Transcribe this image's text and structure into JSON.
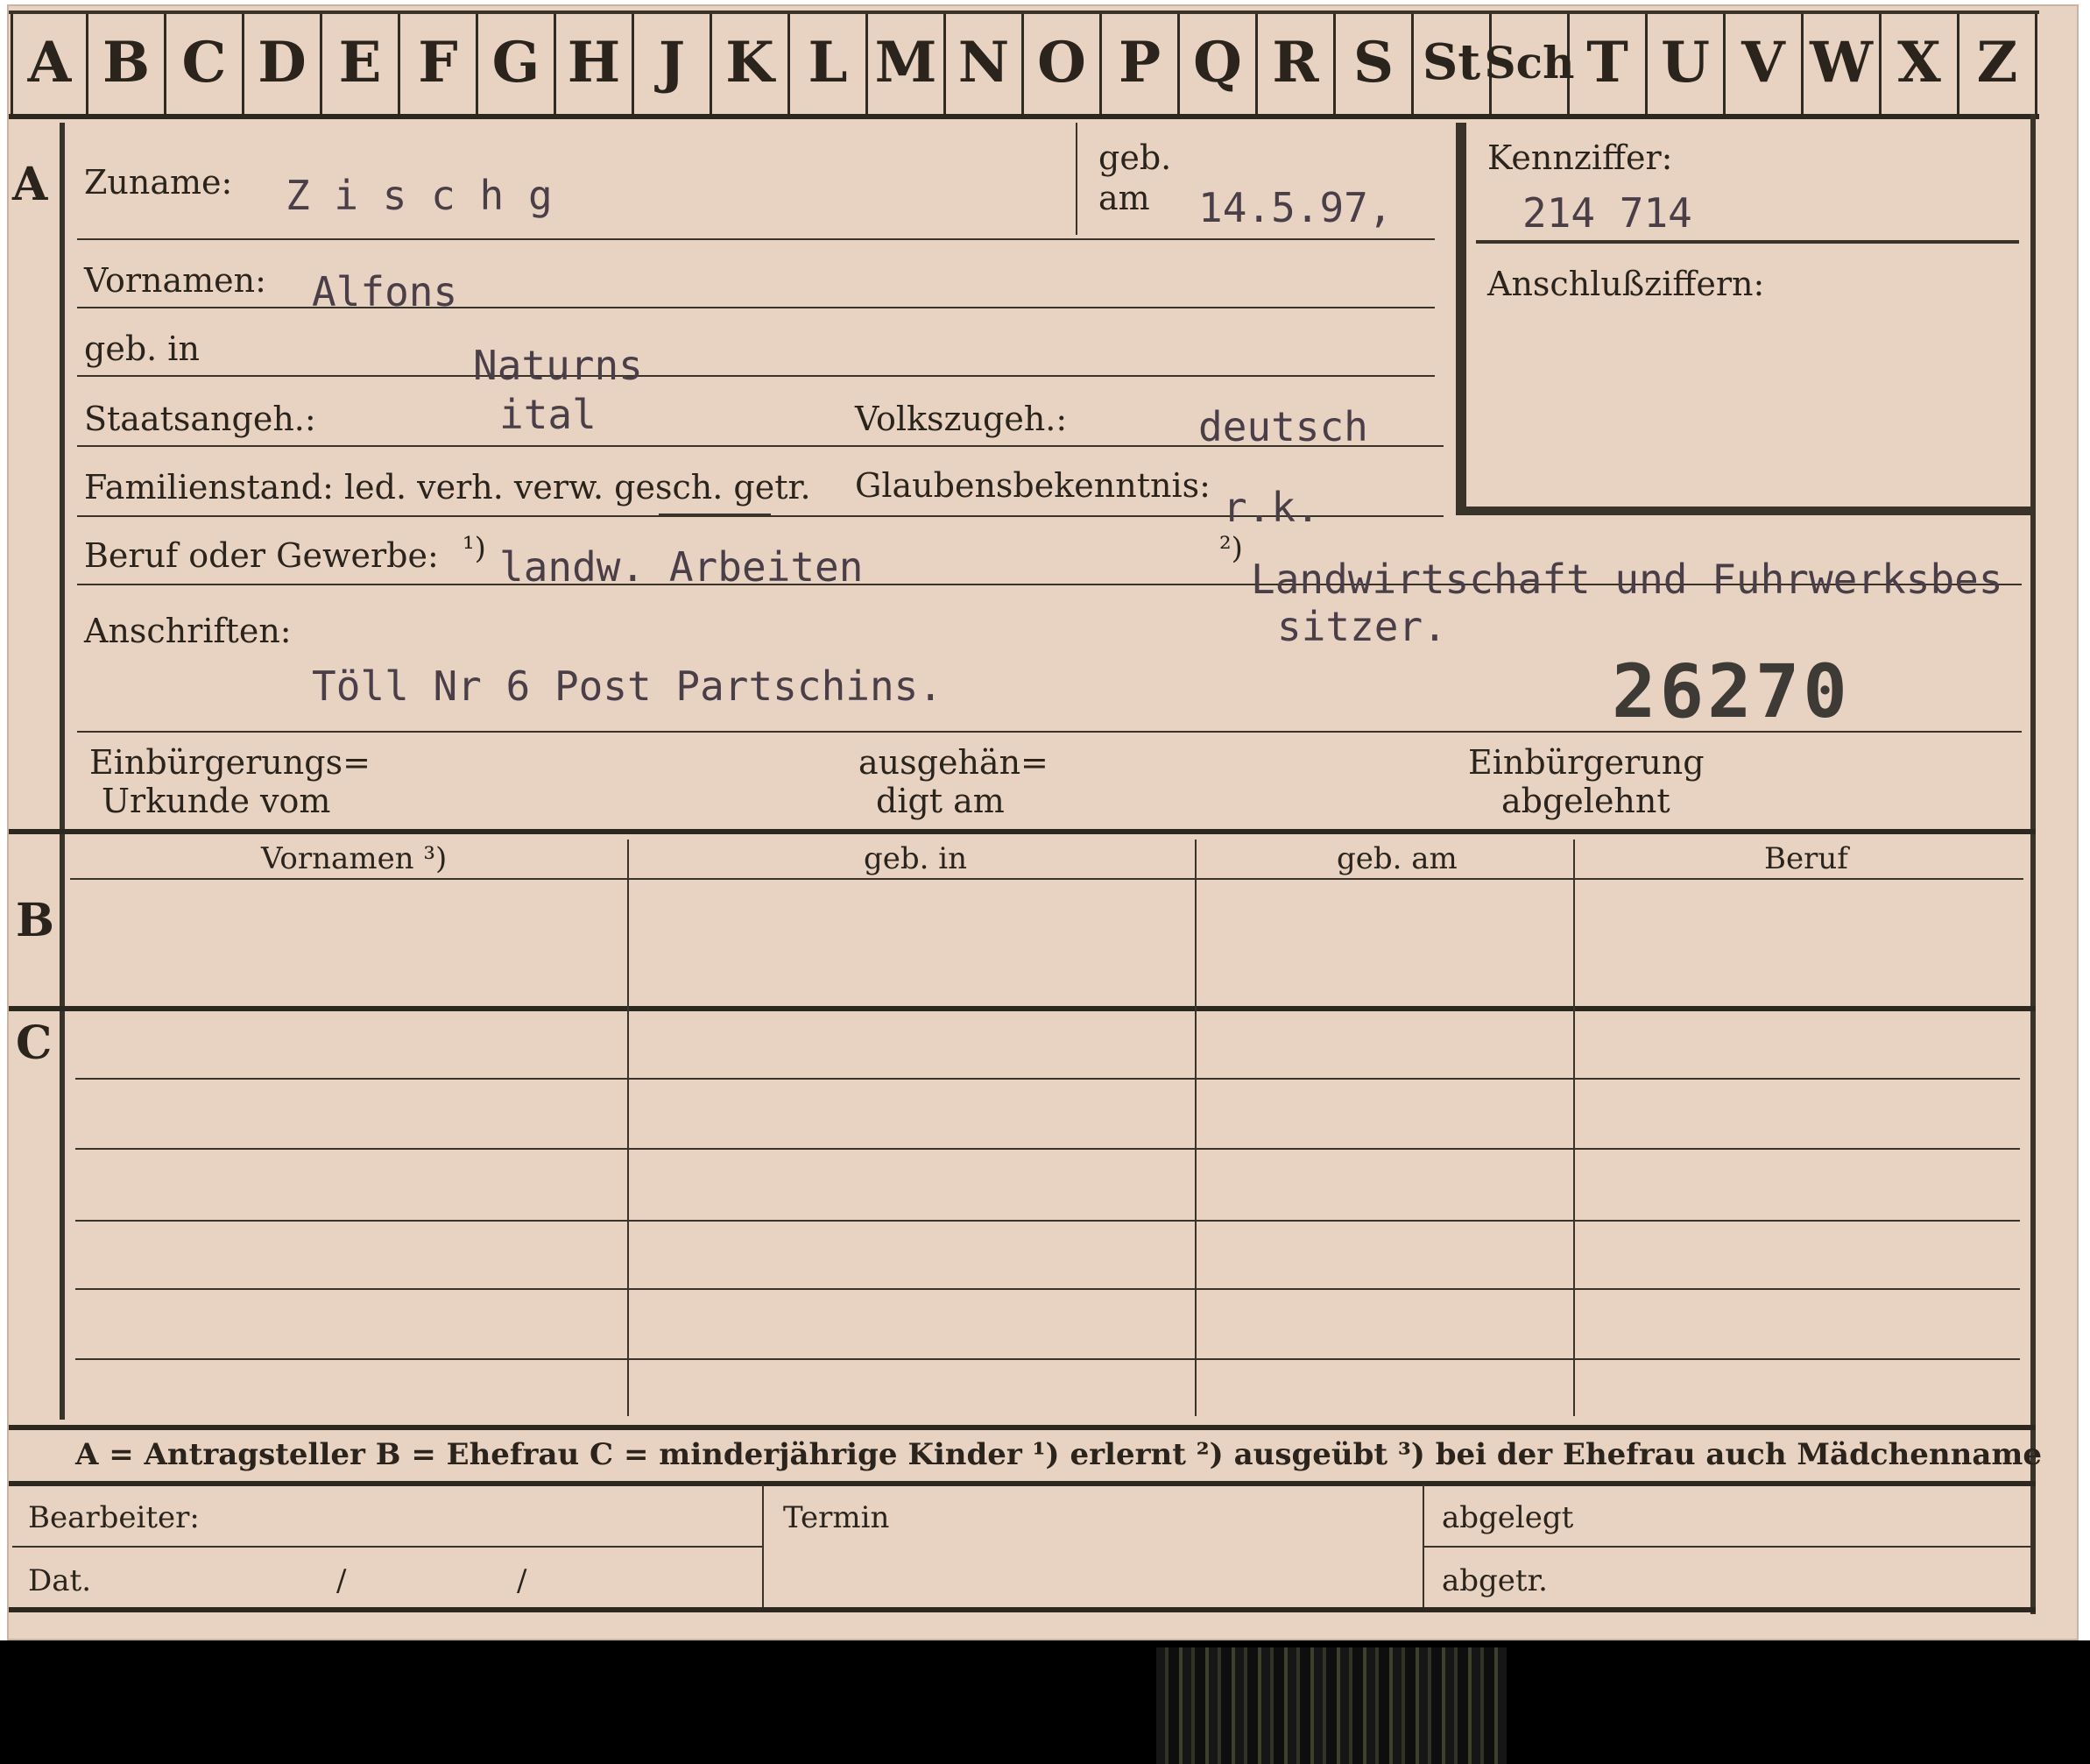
{
  "alphabet_tabs": [
    "A",
    "B",
    "C",
    "D",
    "E",
    "F",
    "G",
    "H",
    "J",
    "K",
    "L",
    "M",
    "N",
    "O",
    "P",
    "Q",
    "R",
    "S",
    "St",
    "Sch",
    "T",
    "U",
    "V",
    "W",
    "X",
    "Z"
  ],
  "section_letters": {
    "a": "A",
    "b": "B",
    "c": "C"
  },
  "header": {
    "zuname_label": "Zuname:",
    "zuname_value": "Z i s c h g",
    "geb_label_1": "geb.",
    "geb_label_2": "am",
    "geb_value": "14.5.97,",
    "kennziffer_label": "Kennziffer:",
    "kennziffer_value": "214 714",
    "anschluss_label": "Anschlußziffern:"
  },
  "person": {
    "vornamen_label": "Vornamen:",
    "vornamen_value": "Alfons",
    "geb_in_label": "geb. in",
    "geb_in_value": "Naturns",
    "staats_label": "Staatsangeh.:",
    "staats_value": "ital",
    "volks_label": "Volkszugeh.:",
    "volks_value": "deutsch",
    "familienstand_label": "Familienstand: led. verh. verw. gesch. getr.",
    "glauben_label": "Glaubensbekenntnis:",
    "glauben_value": "r.k.",
    "beruf_label": "Beruf oder Gewerbe:",
    "beruf_mark_1": "¹)",
    "beruf_value_1": "landw. Arbeiten",
    "beruf_mark_2": "²)",
    "beruf_value_2": "Landwirtschaft und Fuhrwerksbes",
    "beruf_value_2b": "sitzer.",
    "anschriften_label": "Anschriften:",
    "anschriften_value": "Töll Nr 6 Post Partschins.",
    "stamp_number": "26270"
  },
  "einbuergerung": {
    "urkunde_1": "Einbürgerungs=",
    "urkunde_2": "Urkunde vom",
    "ausgehaen_1": "ausgehän=",
    "ausgehaen_2": "digt am",
    "abgelehnt_1": "Einbürgerung",
    "abgelehnt_2": "abgelehnt"
  },
  "table_headers": [
    "Vornamen ³)",
    "geb. in",
    "geb. am",
    "Beruf"
  ],
  "legend": "A = Antragsteller    B = Ehefrau    C = minderjährige Kinder    ¹) erlernt    ²) ausgeübt    ³) bei der Ehefrau auch Mädchenname",
  "footer": {
    "bearbeiter": "Bearbeiter:",
    "dat": "Dat.",
    "slash_1": "/",
    "slash_2": "/",
    "termin": "Termin",
    "abgelegt": "abgelegt",
    "abgetr": "abgetr."
  }
}
